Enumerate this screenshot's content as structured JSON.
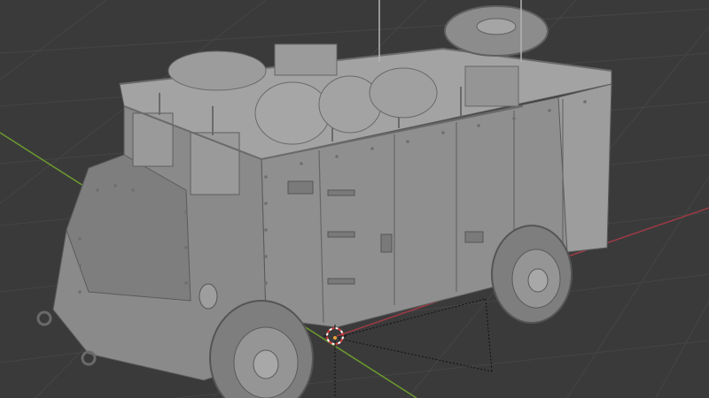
{
  "viewport": {
    "background": "#3a3a3a",
    "grid_color": "#454545",
    "x_axis_color": "#9c3b44",
    "y_axis_color": "#6b9a2f",
    "model": {
      "body_color": "#8f8f8f",
      "body_light": "#a3a3a3",
      "body_dark": "#6d6d6d",
      "tire_color": "#7e7e7e"
    },
    "cursor_icon": "3d-cursor-icon",
    "origin_marker": "object-origin-icon"
  }
}
